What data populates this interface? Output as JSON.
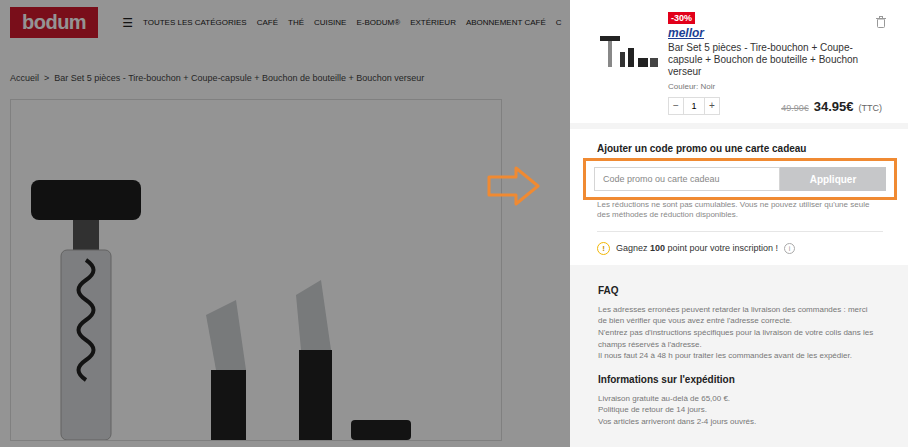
{
  "site": {
    "logo": "bodum",
    "menu_icon": "☰",
    "nav": [
      "TOUTES LES CATÉGORIES",
      "CAFÉ",
      "THÉ",
      "CUISINE",
      "E-BODUM®",
      "EXTÉRIEUR",
      "ABONNEMENT CAFÉ",
      "C"
    ]
  },
  "breadcrumb": {
    "separator": ">",
    "items": [
      "Accueil",
      "Bar Set 5 pièces - Tire-bouchon + Coupe-capsule + Bouchon de bouteille + Bouchon verseur"
    ]
  },
  "cart_item": {
    "badge": "-30%",
    "brand": "mellor",
    "name": "Bar Set 5 pièces - Tire-bouchon + Coupe-capsule + Bouchon de bouteille + Bouchon verseur",
    "color_label": "Couleur: Noir",
    "qty_minus": "−",
    "quantity": "1",
    "qty_plus": "+",
    "old_price": "49.90€",
    "price": "34.95€",
    "tax": "(TTC)"
  },
  "promo": {
    "title": "Ajouter un code promo ou une carte cadeau",
    "placeholder": "Code promo ou carte cadeau",
    "button": "Appliquer",
    "highlighted": true,
    "note": "Les réductions ne sont pas cumulables. Vous ne pouvez utiliser qu'une seule des méthodes de réduction disponibles."
  },
  "points": {
    "icon": "!",
    "before": "Gagnez",
    "amount": "100",
    "after": "point pour votre inscription !",
    "info_icon": "i"
  },
  "faq": {
    "title": "FAQ",
    "paragraphs": [
      "Les adresses erronées peuvent retarder la livraison des commandes : merci de bien vérifier que vous avez entré l'adresse correcte.",
      "N'entrez pas d'instructions spécifiques pour la livraison de votre colis dans les champs réservés à l'adresse.",
      "Il nous faut 24 à 48 h pour traiter les commandes avant de les expédier."
    ]
  },
  "shipping": {
    "title": "Informations sur l'expédition",
    "lines": [
      "Livraison gratuite au-delà de 65,00 €.",
      "Politique de retour de 14 jours.",
      "Vos articles arriveront dans 2-4 jours ouvrés."
    ]
  }
}
